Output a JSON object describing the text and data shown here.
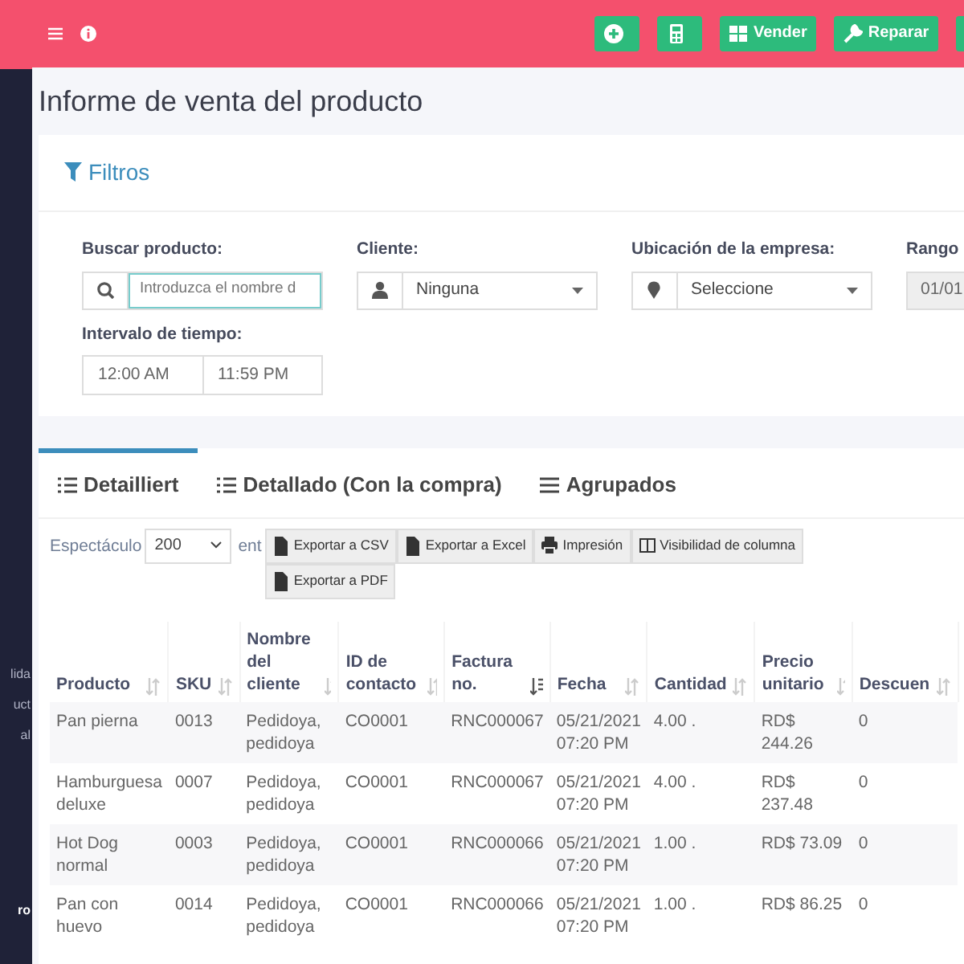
{
  "topbar": {
    "buttons": [
      {
        "kind": "icon"
      },
      {
        "kind": "icon"
      },
      {
        "kind": "labeled",
        "label": "Vender"
      },
      {
        "kind": "labeled",
        "label": "Reparar"
      },
      {
        "kind": "icon"
      }
    ]
  },
  "sidebar": {
    "items": [
      "lida",
      "uct",
      "al",
      "ro"
    ]
  },
  "page_title": "Informe de venta del producto",
  "filters": {
    "title": "Filtros",
    "fields": [
      {
        "kind": "search",
        "label": "Buscar producto:",
        "placeholder": "Introduzca el nombre d"
      },
      {
        "kind": "select",
        "label": "Cliente:",
        "value": "Ninguna"
      },
      {
        "kind": "select",
        "label": "Ubicación de la empresa:",
        "value": "Seleccione"
      },
      {
        "kind": "date",
        "label": "Rango",
        "value": "01/01"
      }
    ],
    "time_interval": {
      "label": "Intervalo de tiempo:",
      "start": "12:00 AM",
      "end": "11:59 PM"
    }
  },
  "tabs": [
    {
      "label": "Detailliert",
      "selected": true
    },
    {
      "label": "Detallado (Con la compra)",
      "selected": false
    },
    {
      "label": "Agrupados",
      "selected": false
    }
  ],
  "length_menu": {
    "label": "Espectáculo",
    "value": "200",
    "suffix": "ent"
  },
  "export_buttons": [
    "Exportar a CSV",
    "Exportar a Excel",
    "Impresión",
    "Visibilidad de columna",
    "Exportar a PDF"
  ],
  "table": {
    "columns": [
      {
        "label": "Producto",
        "sorted": false
      },
      {
        "label": "SKU",
        "sorted": false
      },
      {
        "label": "Nombre del cliente",
        "sorted": false
      },
      {
        "label": "ID de contacto",
        "sorted": false
      },
      {
        "label": "Factura no.",
        "sorted": true
      },
      {
        "label": "Fecha",
        "sorted": false
      },
      {
        "label": "Cantidad",
        "sorted": false
      },
      {
        "label": "Precio unitario",
        "sorted": false
      },
      {
        "label": "Descuen",
        "sorted": false
      }
    ],
    "rows": [
      [
        "Pan pierna",
        "0013",
        "Pedidoya, pedidoya",
        "CO0001",
        "RNC000067",
        "05/21/2021 07:20 PM",
        "4.00 .",
        "RD$ 244.26",
        "0"
      ],
      [
        "Hamburguesa deluxe",
        "0007",
        "Pedidoya, pedidoya",
        "CO0001",
        "RNC000067",
        "05/21/2021 07:20 PM",
        "4.00 .",
        "RD$ 237.48",
        "0"
      ],
      [
        "Hot Dog normal",
        "0003",
        "Pedidoya, pedidoya",
        "CO0001",
        "RNC000066",
        "05/21/2021 07:20 PM",
        "1.00 .",
        "RD$ 73.09",
        "0"
      ],
      [
        "Pan con huevo",
        "0014",
        "Pedidoya, pedidoya",
        "CO0001",
        "RNC000066",
        "05/21/2021 07:20 PM",
        "1.00 .",
        "RD$ 86.25",
        "0"
      ]
    ]
  }
}
